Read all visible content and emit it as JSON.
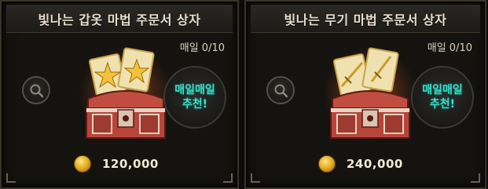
{
  "cards": [
    {
      "title": "빛나는 갑옷 마법 주문서 상자",
      "daily_limit": "매일 0/10",
      "recommend_line1": "매일매일",
      "recommend_line2": "추천!",
      "price": "120,000",
      "scroll_icon": "star-scroll-icon"
    },
    {
      "title": "빛나는 무기 마법 주문서 상자",
      "daily_limit": "매일 0/10",
      "recommend_line1": "매일매일",
      "recommend_line2": "추천!",
      "price": "240,000",
      "scroll_icon": "sword-scroll-icon"
    }
  ],
  "colors": {
    "accent_teal": "#3ce0c8",
    "gold": "#e0a418",
    "chest_red": "#b8453a"
  }
}
